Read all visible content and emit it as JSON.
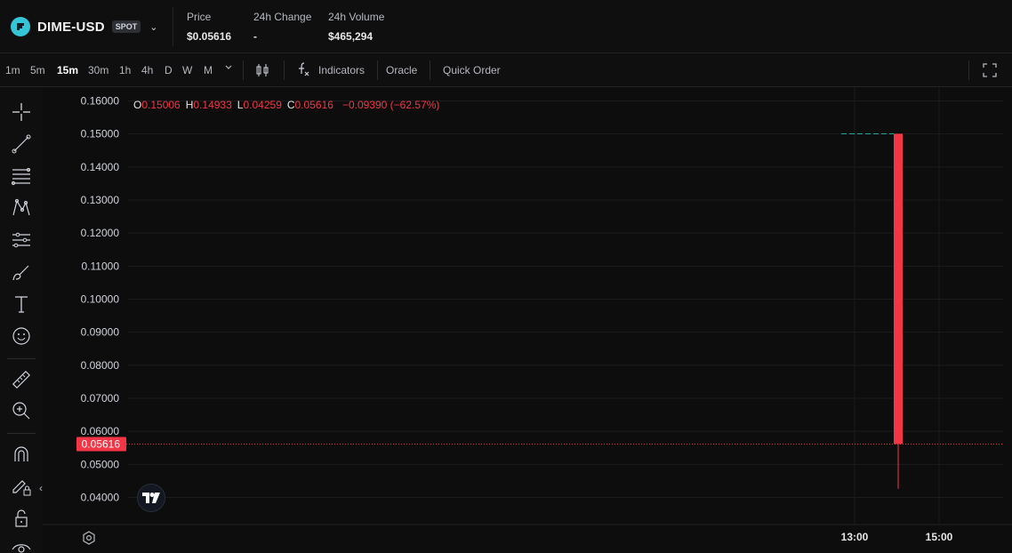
{
  "header": {
    "pair": "DIME-USD",
    "market_type": "SPOT",
    "stats": [
      {
        "label": "Price",
        "value": "$0.05616"
      },
      {
        "label": "24h Change",
        "value": "-"
      },
      {
        "label": "24h Volume",
        "value": "$465,294"
      }
    ]
  },
  "toolbar": {
    "intervals": [
      "1m",
      "5m",
      "15m",
      "30m",
      "1h",
      "4h",
      "D",
      "W",
      "M"
    ],
    "active_interval": "15m",
    "indicators_label": "Indicators",
    "oracle_label": "Oracle",
    "quick_order_label": "Quick Order"
  },
  "left_tools": [
    "crosshair-icon",
    "trend-line-icon",
    "fib-retracement-icon",
    "pattern-icon",
    "prediction-icon",
    "brush-icon",
    "text-icon",
    "emoji-icon",
    "ruler-icon",
    "zoom-in-icon",
    "magnet-icon",
    "lock-drawing-icon",
    "lock-icon",
    "eye-icon"
  ],
  "legend": {
    "o_label": "O",
    "o_value": "0.15006",
    "h_label": "H",
    "h_value": "0.14933",
    "l_label": "L",
    "l_value": "0.04259",
    "c_label": "C",
    "c_value": "0.05616",
    "change": "−0.09390 (−62.57%)"
  },
  "colors": {
    "down": "#f23645",
    "up_dash": "#26a69a",
    "price_tag": "#f23645",
    "background": "#0d0d0e"
  },
  "chart_data": {
    "type": "candlestick",
    "y_ticks": [
      "0.16000",
      "0.15000",
      "0.14000",
      "0.13000",
      "0.12000",
      "0.11000",
      "0.10000",
      "0.09000",
      "0.08000",
      "0.07000",
      "0.06000",
      "0.05000",
      "0.04000"
    ],
    "ylim": [
      0.036,
      0.163
    ],
    "x_ticks": [
      "13:00",
      "15:00"
    ],
    "candles": [
      {
        "open": 0.15006,
        "high": 0.15006,
        "low": 0.04259,
        "close": 0.05616
      }
    ],
    "current_price_label": "0.05616",
    "current_price": 0.05616
  }
}
